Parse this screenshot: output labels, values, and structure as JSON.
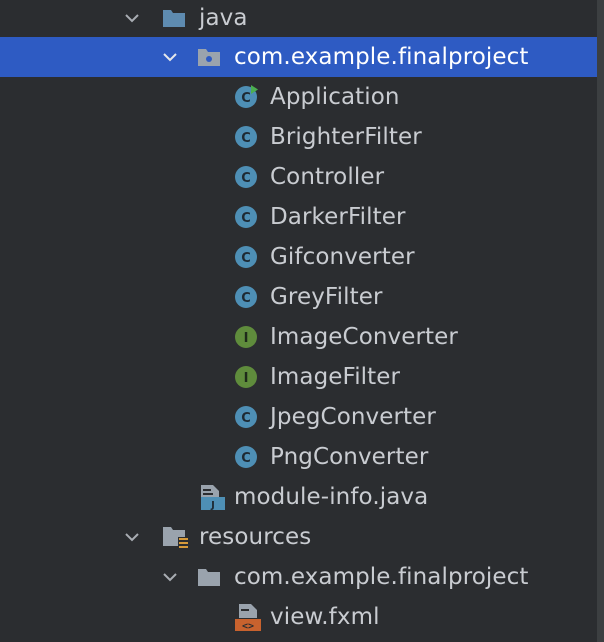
{
  "tree": {
    "items": [
      {
        "label": "java",
        "icon": "source-folder-icon",
        "expanded": true
      },
      {
        "label": "com.example.finalproject",
        "icon": "package-icon",
        "expanded": true,
        "selected": true
      },
      {
        "label": "Application",
        "icon": "class-run-icon"
      },
      {
        "label": "BrighterFilter",
        "icon": "class-icon"
      },
      {
        "label": "Controller",
        "icon": "class-icon"
      },
      {
        "label": "DarkerFilter",
        "icon": "class-icon"
      },
      {
        "label": "Gifconverter",
        "icon": "class-icon"
      },
      {
        "label": "GreyFilter",
        "icon": "class-icon"
      },
      {
        "label": "ImageConverter",
        "icon": "interface-icon"
      },
      {
        "label": "ImageFilter",
        "icon": "interface-icon"
      },
      {
        "label": "JpegConverter",
        "icon": "class-icon"
      },
      {
        "label": "PngConverter",
        "icon": "class-icon"
      },
      {
        "label": "module-info.java",
        "icon": "module-info-icon"
      },
      {
        "label": "resources",
        "icon": "resources-folder-icon",
        "expanded": true
      },
      {
        "label": "com.example.finalproject",
        "icon": "folder-icon",
        "expanded": true
      },
      {
        "label": "view.fxml",
        "icon": "fxml-file-icon"
      }
    ]
  },
  "colors": {
    "background": "#2b2d30",
    "selection": "#2e5bc3",
    "class_icon": "#4e8fb5",
    "interface_icon": "#5f8c3c",
    "run_badge": "#4caf50",
    "folder": "#8a9199"
  }
}
